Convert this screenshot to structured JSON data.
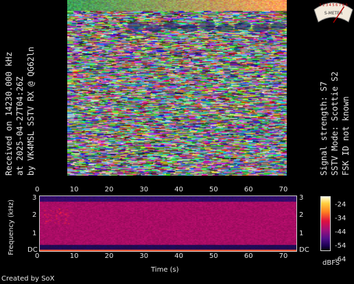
{
  "left_caption": {
    "line1": "Received on  14230.000 kHz",
    "line2": "at 2025-04-27T04:26Z",
    "line3": "by VK4MSL SSTV RX @ QG62ln"
  },
  "right_caption": {
    "line1": "Signal strength: S7",
    "line2": "SSTV Mode: Scottie S2",
    "line3": "FSK ID not known"
  },
  "smeter": {
    "scale_label": "1 2 3 4 5 6 7 8 9",
    "unit_label": "S-METER",
    "reading": "S7",
    "needle_level": 0.78
  },
  "spectrogram": {
    "x_label": "Time (s)",
    "y_label": "Frequency (kHz)",
    "x_ticks": [
      "0",
      "10",
      "20",
      "30",
      "40",
      "50",
      "60",
      "70"
    ],
    "y_ticks": [
      "3",
      "2",
      "1",
      "DC"
    ],
    "colorbar_ticks": [
      "-24",
      "-34",
      "-44",
      "-54",
      "-64"
    ],
    "colorbar_unit": "dBFS"
  },
  "footer": "Created by SoX"
}
